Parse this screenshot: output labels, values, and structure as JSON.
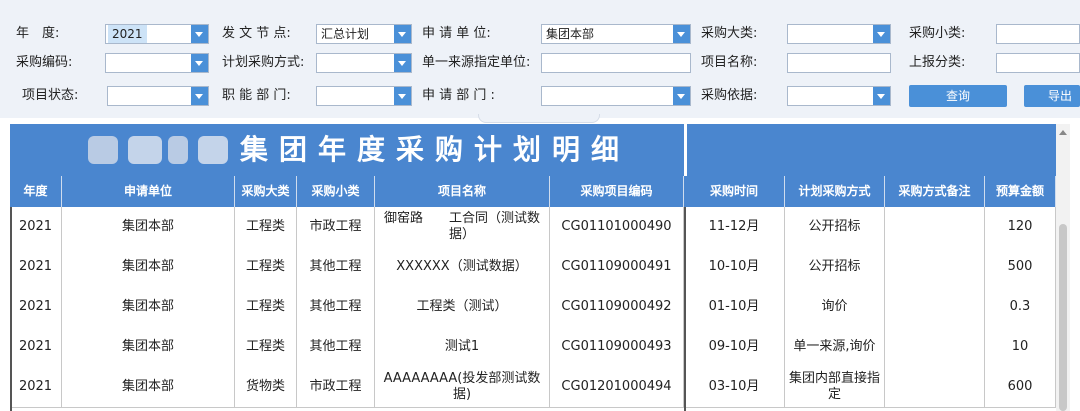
{
  "filters": {
    "year_label": "年　度:",
    "year_value": "2021",
    "node_label": "发 文 节 点:",
    "node_value": "汇总计划",
    "applicant_label": "申 请 单 位:",
    "applicant_value": "集团本部",
    "category_label": "采购大类:",
    "subcategory_label": "采购小类:",
    "code_label": "采购编码:",
    "method_label": "计划采购方式:",
    "single_source_label": "单一来源指定单位:",
    "project_name_label": "项目名称:",
    "report_category_label": "上报分类:",
    "status_label": "项目状态:",
    "department_label": "职 能 部 门:",
    "apply_department_label": "申 请 部 门 :",
    "basis_label": "采购依据:",
    "query_button": "查询",
    "export_button": "导出"
  },
  "grid": {
    "title": "集团年度采购计划明细",
    "columns": [
      "年度",
      "申请单位",
      "采购大类",
      "采购小类",
      "项目名称",
      "采购项目编码",
      "采购时间",
      "计划采购方式",
      "采购方式备注",
      "预算金额"
    ],
    "rows": [
      [
        "2021",
        "集团本部",
        "工程类",
        "市政工程",
        "御窑路　　工合同（测试数据）",
        "CG01101000490",
        "11-12月",
        "公开招标",
        "",
        "120"
      ],
      [
        "2021",
        "集团本部",
        "工程类",
        "其他工程",
        "XXXXXX（测试数据）",
        "CG01109000491",
        "10-10月",
        "公开招标",
        "",
        "500"
      ],
      [
        "2021",
        "集团本部",
        "工程类",
        "其他工程",
        "工程类（测试）",
        "CG01109000492",
        "01-10月",
        "询价",
        "",
        "0.3"
      ],
      [
        "2021",
        "集团本部",
        "工程类",
        "其他工程",
        "测试1",
        "CG01109000493",
        "09-10月",
        "单一来源,询价",
        "",
        "10"
      ],
      [
        "2021",
        "集团本部",
        "货物类",
        "市政工程",
        "AAAAAAAA(投发部测试数据)",
        "CG01201000494",
        "03-10月",
        "集团内部直接指定",
        "",
        "600"
      ]
    ]
  },
  "colors": {
    "header_blue": "#4a86cf",
    "button_blue": "#4a90d8",
    "filter_bg": "#eef2f8"
  }
}
